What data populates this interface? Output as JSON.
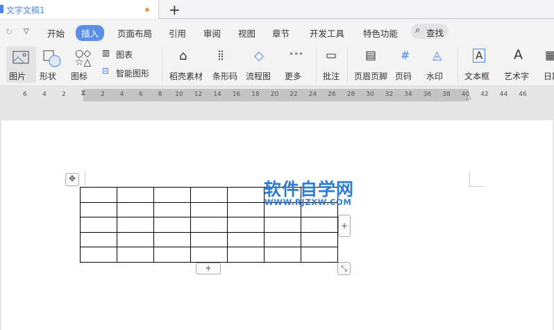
{
  "title_tab": {
    "label": "文字文稿1",
    "new_tab": "+"
  },
  "menu": {
    "items": [
      "开始",
      "插入",
      "页面布局",
      "引用",
      "审阅",
      "视图",
      "章节",
      "开发工具",
      "特色功能"
    ],
    "active": "插入",
    "search": "查找"
  },
  "ribbon": {
    "buttons": [
      "图片",
      "形状",
      "图标",
      "图表",
      "智能图形",
      "稻壳素材",
      "条形码",
      "流程图",
      "更多",
      "批注",
      "页眉页脚",
      "页码",
      "水印",
      "文本框",
      "艺术字",
      "日期"
    ]
  },
  "ruler": {
    "left": [
      "6",
      "4",
      "2"
    ],
    "right": [
      "2",
      "4",
      "6",
      "8",
      "10",
      "12",
      "14",
      "16",
      "18",
      "20",
      "22",
      "24",
      "26",
      "28",
      "30",
      "32",
      "34",
      "36",
      "38",
      "40",
      "42",
      "44",
      "46"
    ]
  },
  "table": {
    "rows": 5,
    "cols": 7
  },
  "watermark": {
    "title": "软件自学网",
    "url": "WWW.RJZXW.COM"
  },
  "colors": {
    "accent": "#5b8ee6",
    "watermark": "#2c7cd6"
  }
}
